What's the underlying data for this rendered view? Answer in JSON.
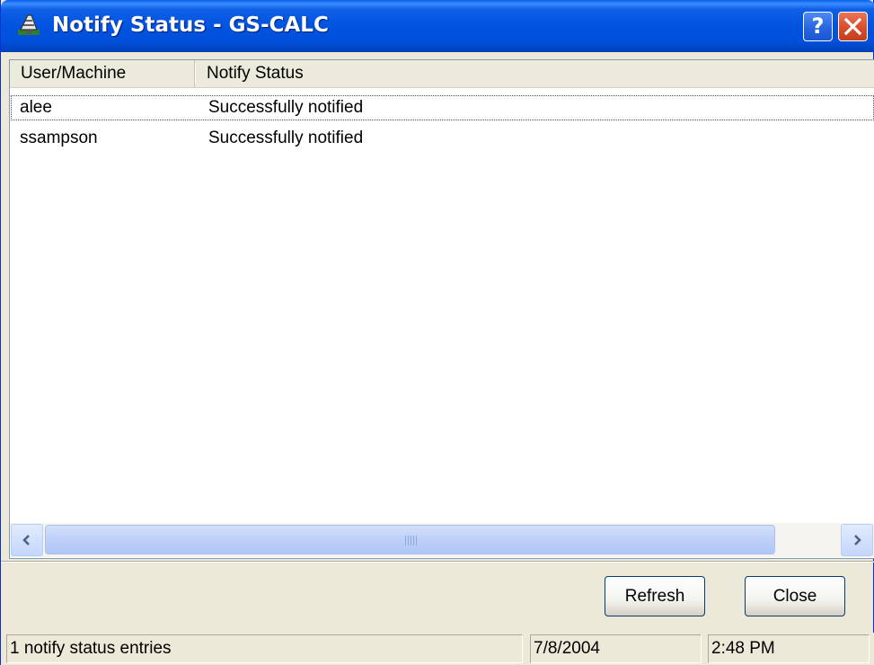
{
  "window": {
    "title": "Notify Status - GS-CALC",
    "help_label": "?",
    "colors": {
      "titlebar": "#0054e3",
      "close": "#d94d2b",
      "face": "#ece9d8"
    }
  },
  "list": {
    "columns": [
      "User/Machine",
      "Notify Status"
    ],
    "rows": [
      {
        "user": "alee",
        "status": "Successfully notified"
      },
      {
        "user": "ssampson",
        "status": "Successfully notified"
      }
    ]
  },
  "buttons": {
    "refresh": "Refresh",
    "close": "Close"
  },
  "statusbar": {
    "message": "1 notify status entries",
    "date": "7/8/2004",
    "time": "2:48 PM"
  }
}
